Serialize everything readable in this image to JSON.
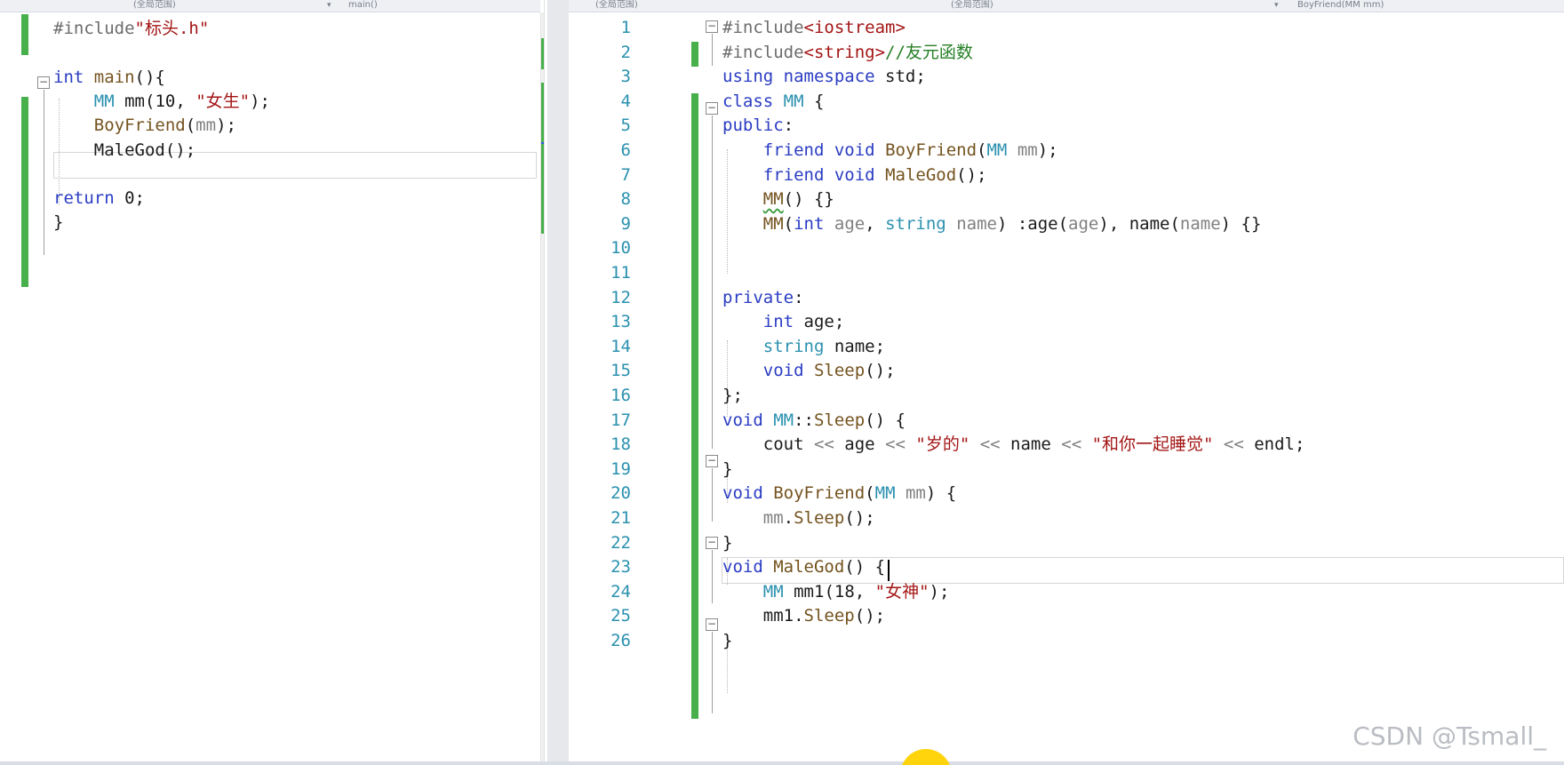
{
  "left_editor": {
    "nav_dropdowns": [
      "(全局范围)",
      "main()"
    ],
    "lines": [
      {
        "tokens": [
          {
            "t": "#include",
            "c": "pp"
          },
          {
            "t": "\"标头.h\"",
            "c": "str"
          }
        ]
      },
      {
        "tokens": []
      },
      {
        "tokens": [
          {
            "t": "int",
            "c": "kw"
          },
          {
            "t": " ",
            "c": "pl"
          },
          {
            "t": "main",
            "c": "fn"
          },
          {
            "t": "(){",
            "c": "pl"
          }
        ]
      },
      {
        "tokens": [
          {
            "t": "    ",
            "c": "pl"
          },
          {
            "t": "MM",
            "c": "tp"
          },
          {
            "t": " ",
            "c": "pl"
          },
          {
            "t": "mm",
            "c": "pl"
          },
          {
            "t": "(10, ",
            "c": "pl"
          },
          {
            "t": "\"女生\"",
            "c": "str"
          },
          {
            "t": ");",
            "c": "pl"
          }
        ]
      },
      {
        "tokens": [
          {
            "t": "    ",
            "c": "pl"
          },
          {
            "t": "BoyFriend",
            "c": "fn"
          },
          {
            "t": "(",
            "c": "pl"
          },
          {
            "t": "mm",
            "c": "prm"
          },
          {
            "t": ");",
            "c": "pl"
          }
        ]
      },
      {
        "tokens": [
          {
            "t": "    ",
            "c": "pl"
          },
          {
            "t": "MaleGod",
            "c": "pl"
          },
          {
            "t": "();",
            "c": "pl"
          }
        ]
      },
      {
        "tokens": []
      },
      {
        "tokens": [
          {
            "t": "return",
            "c": "kw"
          },
          {
            "t": " 0;",
            "c": "pl"
          }
        ]
      },
      {
        "tokens": [
          {
            "t": "}",
            "c": "pl"
          }
        ]
      }
    ]
  },
  "right_editor": {
    "nav_dropdowns": [
      "(全局范围)",
      "(全局范围)",
      "BoyFriend(MM mm)"
    ],
    "lines": [
      {
        "num": "1",
        "tokens": [
          {
            "t": "#include",
            "c": "pp"
          },
          {
            "t": "<iostream>",
            "c": "str"
          }
        ]
      },
      {
        "num": "2",
        "tokens": [
          {
            "t": "#include",
            "c": "pp"
          },
          {
            "t": "<string>",
            "c": "str"
          },
          {
            "t": "//友元函数",
            "c": "cm"
          }
        ]
      },
      {
        "num": "3",
        "tokens": [
          {
            "t": "using",
            "c": "kw"
          },
          {
            "t": " ",
            "c": "pl"
          },
          {
            "t": "namespace",
            "c": "kw"
          },
          {
            "t": " std;",
            "c": "pl"
          }
        ]
      },
      {
        "num": "4",
        "tokens": [
          {
            "t": "class",
            "c": "kw"
          },
          {
            "t": " ",
            "c": "pl"
          },
          {
            "t": "MM",
            "c": "tp"
          },
          {
            "t": " {",
            "c": "pl"
          }
        ]
      },
      {
        "num": "5",
        "tokens": [
          {
            "t": "public",
            "c": "kw"
          },
          {
            "t": ":",
            "c": "pl"
          }
        ]
      },
      {
        "num": "6",
        "tokens": [
          {
            "t": "    ",
            "c": "pl"
          },
          {
            "t": "friend",
            "c": "kw"
          },
          {
            "t": " ",
            "c": "pl"
          },
          {
            "t": "void",
            "c": "kw"
          },
          {
            "t": " ",
            "c": "pl"
          },
          {
            "t": "BoyFriend",
            "c": "fn"
          },
          {
            "t": "(",
            "c": "pl"
          },
          {
            "t": "MM",
            "c": "tp"
          },
          {
            "t": " ",
            "c": "pl"
          },
          {
            "t": "mm",
            "c": "prm"
          },
          {
            "t": ");",
            "c": "pl"
          }
        ]
      },
      {
        "num": "7",
        "tokens": [
          {
            "t": "    ",
            "c": "pl"
          },
          {
            "t": "friend",
            "c": "kw"
          },
          {
            "t": " ",
            "c": "pl"
          },
          {
            "t": "void",
            "c": "kw"
          },
          {
            "t": " ",
            "c": "pl"
          },
          {
            "t": "MaleGod",
            "c": "fn"
          },
          {
            "t": "();",
            "c": "pl"
          }
        ]
      },
      {
        "num": "8",
        "tokens": [
          {
            "t": "    ",
            "c": "pl"
          },
          {
            "t": "MM",
            "c": "fn",
            "squig": true
          },
          {
            "t": "() {}",
            "c": "pl"
          }
        ]
      },
      {
        "num": "9",
        "tokens": [
          {
            "t": "    ",
            "c": "pl"
          },
          {
            "t": "MM",
            "c": "fn"
          },
          {
            "t": "(",
            "c": "pl"
          },
          {
            "t": "int",
            "c": "kw"
          },
          {
            "t": " ",
            "c": "pl"
          },
          {
            "t": "age",
            "c": "prm"
          },
          {
            "t": ", ",
            "c": "pl"
          },
          {
            "t": "string",
            "c": "tp"
          },
          {
            "t": " ",
            "c": "pl"
          },
          {
            "t": "name",
            "c": "prm"
          },
          {
            "t": ") :age(",
            "c": "pl"
          },
          {
            "t": "age",
            "c": "prm"
          },
          {
            "t": "), name(",
            "c": "pl"
          },
          {
            "t": "name",
            "c": "prm"
          },
          {
            "t": ") {}",
            "c": "pl"
          }
        ]
      },
      {
        "num": "10",
        "tokens": []
      },
      {
        "num": "11",
        "tokens": []
      },
      {
        "num": "12",
        "tokens": [
          {
            "t": "private",
            "c": "kw"
          },
          {
            "t": ":",
            "c": "pl"
          }
        ]
      },
      {
        "num": "13",
        "tokens": [
          {
            "t": "    ",
            "c": "pl"
          },
          {
            "t": "int",
            "c": "kw"
          },
          {
            "t": " age;",
            "c": "pl"
          }
        ]
      },
      {
        "num": "14",
        "tokens": [
          {
            "t": "    ",
            "c": "pl"
          },
          {
            "t": "string",
            "c": "tp"
          },
          {
            "t": " name;",
            "c": "pl"
          }
        ]
      },
      {
        "num": "15",
        "tokens": [
          {
            "t": "    ",
            "c": "pl"
          },
          {
            "t": "void",
            "c": "kw"
          },
          {
            "t": " ",
            "c": "pl"
          },
          {
            "t": "Sleep",
            "c": "fn"
          },
          {
            "t": "();",
            "c": "pl"
          }
        ]
      },
      {
        "num": "16",
        "tokens": [
          {
            "t": "};",
            "c": "pl"
          }
        ]
      },
      {
        "num": "17",
        "tokens": [
          {
            "t": "void",
            "c": "kw"
          },
          {
            "t": " ",
            "c": "pl"
          },
          {
            "t": "MM",
            "c": "tp"
          },
          {
            "t": "::",
            "c": "pl"
          },
          {
            "t": "Sleep",
            "c": "fn"
          },
          {
            "t": "() {",
            "c": "pl"
          }
        ]
      },
      {
        "num": "18",
        "tokens": [
          {
            "t": "    ",
            "c": "pl"
          },
          {
            "t": "cout",
            "c": "pl"
          },
          {
            "t": " << ",
            "c": "prm"
          },
          {
            "t": "age",
            "c": "pl"
          },
          {
            "t": " << ",
            "c": "prm"
          },
          {
            "t": "\"岁的\"",
            "c": "str"
          },
          {
            "t": " << ",
            "c": "prm"
          },
          {
            "t": "name",
            "c": "pl"
          },
          {
            "t": " << ",
            "c": "prm"
          },
          {
            "t": "\"和你一起睡觉\"",
            "c": "str"
          },
          {
            "t": " << ",
            "c": "prm"
          },
          {
            "t": "endl;",
            "c": "pl"
          }
        ]
      },
      {
        "num": "19",
        "tokens": [
          {
            "t": "}",
            "c": "pl"
          }
        ]
      },
      {
        "num": "20",
        "tokens": [
          {
            "t": "void",
            "c": "kw"
          },
          {
            "t": " ",
            "c": "pl"
          },
          {
            "t": "BoyFriend",
            "c": "fn"
          },
          {
            "t": "(",
            "c": "pl"
          },
          {
            "t": "MM",
            "c": "tp"
          },
          {
            "t": " ",
            "c": "pl"
          },
          {
            "t": "mm",
            "c": "prm"
          },
          {
            "t": ") {",
            "c": "pl"
          }
        ]
      },
      {
        "num": "21",
        "tokens": [
          {
            "t": "    ",
            "c": "pl"
          },
          {
            "t": "mm",
            "c": "prm"
          },
          {
            "t": ".",
            "c": "pl"
          },
          {
            "t": "Sleep",
            "c": "fn"
          },
          {
            "t": "();",
            "c": "pl"
          }
        ]
      },
      {
        "num": "22",
        "tokens": [
          {
            "t": "}",
            "c": "pl"
          }
        ]
      },
      {
        "num": "23",
        "tokens": [
          {
            "t": "void",
            "c": "kw"
          },
          {
            "t": " ",
            "c": "pl"
          },
          {
            "t": "MaleGod",
            "c": "fn"
          },
          {
            "t": "() {",
            "c": "pl"
          }
        ]
      },
      {
        "num": "24",
        "tokens": [
          {
            "t": "    ",
            "c": "pl"
          },
          {
            "t": "MM",
            "c": "tp"
          },
          {
            "t": " ",
            "c": "pl"
          },
          {
            "t": "mm1",
            "c": "pl"
          },
          {
            "t": "(18, ",
            "c": "pl"
          },
          {
            "t": "\"女神\"",
            "c": "str"
          },
          {
            "t": ");",
            "c": "pl"
          }
        ]
      },
      {
        "num": "25",
        "tokens": [
          {
            "t": "    ",
            "c": "pl"
          },
          {
            "t": "mm1",
            "c": "pl"
          },
          {
            "t": ".",
            "c": "pl"
          },
          {
            "t": "Sleep",
            "c": "fn"
          },
          {
            "t": "();",
            "c": "pl"
          }
        ]
      },
      {
        "num": "26",
        "tokens": [
          {
            "t": "}",
            "c": "pl"
          }
        ]
      }
    ]
  },
  "watermark": "CSDN @Tsmall_",
  "colors": {
    "keyword": "#2a3cc2",
    "preprocessor": "#6c6c6c",
    "string": "#a31515",
    "type": "#2b91af",
    "function": "#74531f",
    "parameter": "#808080",
    "comment": "#267f26",
    "change_bar": "#47b04b",
    "line_number": "#2b91af"
  },
  "icons": {
    "fold_expanded": "−",
    "scroll_up": "▲",
    "scroll_down": "▼",
    "dropdown_caret": "▾"
  }
}
